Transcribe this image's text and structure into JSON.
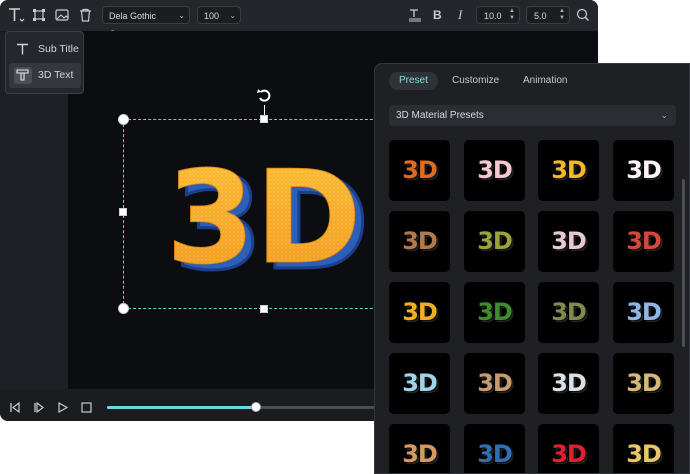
{
  "toolbar": {
    "font_family": "Dela Gothic One...",
    "font_size": "100",
    "line_spacing": "10.0",
    "letter_spacing": "5.0"
  },
  "text_menu": {
    "items": [
      {
        "label": "Sub Title"
      },
      {
        "label": "3D Text"
      }
    ],
    "active": "3D Text"
  },
  "canvas": {
    "text": "3D"
  },
  "playback": {
    "progress": 0.55
  },
  "panel": {
    "tabs": [
      {
        "label": "Preset",
        "active": true
      },
      {
        "label": "Customize",
        "active": false
      },
      {
        "label": "Animation",
        "active": false
      }
    ],
    "preset_category": "3D Material Presets",
    "presets": [
      {
        "text": "3D",
        "color": "#e06a1e"
      },
      {
        "text": "3D",
        "color": "#f4c7d3"
      },
      {
        "text": "3D",
        "color": "#f2b82a"
      },
      {
        "text": "3D",
        "color": "#fff4f7"
      },
      {
        "text": "3D",
        "color": "#b07a4b"
      },
      {
        "text": "3D",
        "color": "#9aa33a"
      },
      {
        "text": "3D",
        "color": "#e8c8d2"
      },
      {
        "text": "3D",
        "color": "#d9463c"
      },
      {
        "text": "3D",
        "color": "#f0b01f"
      },
      {
        "text": "3D",
        "color": "#3f8d2c"
      },
      {
        "text": "3D",
        "color": "#7f8a50"
      },
      {
        "text": "3D",
        "color": "#8fb6e6"
      },
      {
        "text": "3D",
        "color": "#9fd3ea"
      },
      {
        "text": "3D",
        "color": "#c79a70"
      },
      {
        "text": "3D",
        "color": "#d9dfe3"
      },
      {
        "text": "3D",
        "color": "#d8b878"
      },
      {
        "text": "3D",
        "color": "#d49a62"
      },
      {
        "text": "3D",
        "color": "#2f6fb3"
      },
      {
        "text": "3D",
        "color": "#e02030"
      },
      {
        "text": "3D",
        "color": "#e8c66a"
      }
    ]
  },
  "colors": {
    "accent": "#69d5c0",
    "text_3d_face": "#f7a92b",
    "text_3d_side": "#2b5fb8"
  }
}
